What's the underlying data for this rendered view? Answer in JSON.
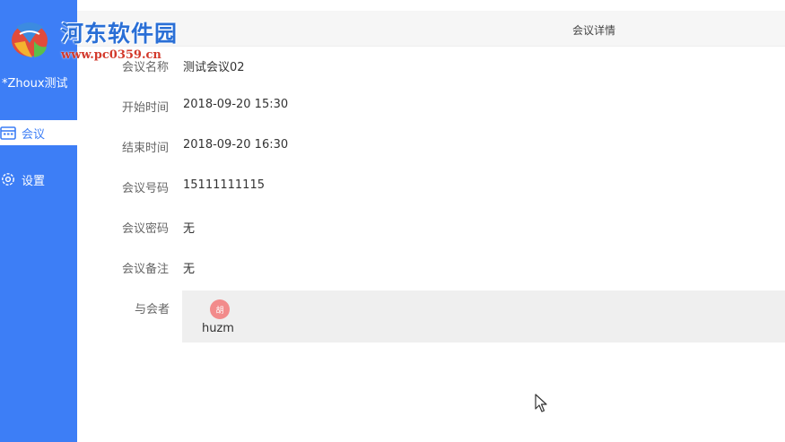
{
  "watermark": {
    "title": "河东软件园",
    "url": "www.pc0359.cn"
  },
  "sidebar": {
    "user_name": "*Zhoux测试",
    "items": [
      {
        "label": "会议",
        "icon": "calendar-icon",
        "active": true
      },
      {
        "label": "设置",
        "icon": "gear-icon",
        "active": false
      }
    ]
  },
  "page": {
    "title": "会议详情"
  },
  "details": {
    "name_label": "会议名称",
    "name_value": "测试会议02",
    "start_label": "开始时间",
    "start_value": "2018-09-20 15:30",
    "end_label": "结束时间",
    "end_value": "2018-09-20 16:30",
    "number_label": "会议号码",
    "number_value": "15111111115",
    "password_label": "会议密码",
    "password_value": "无",
    "note_label": "会议备注",
    "note_value": "无",
    "attendees_label": "与会者"
  },
  "attendees": [
    {
      "avatar_text": "胡",
      "name": "huzm"
    }
  ],
  "colors": {
    "sidebar": "#3d7ef6",
    "avatar": "#f28b8b",
    "attendee_box": "#efefef"
  }
}
